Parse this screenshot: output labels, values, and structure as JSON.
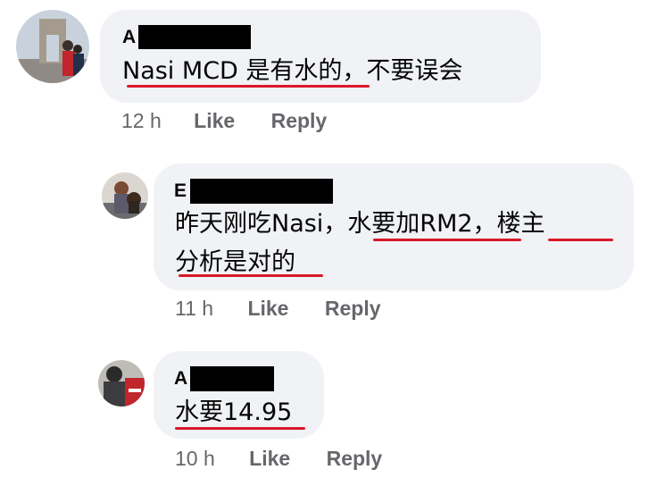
{
  "comments": [
    {
      "author_initial": "A",
      "lines": [
        "Nasi MCD 是有水的，不要误会"
      ],
      "time": "12 h",
      "like": "Like",
      "reply": "Reply"
    },
    {
      "author_initial": "E",
      "lines": [
        "昨天刚吃Nasi，水要加RM2，楼主",
        "分析是对的"
      ],
      "time": "11 h",
      "like": "Like",
      "reply": "Reply"
    },
    {
      "author_initial": "A",
      "lines": [
        "水要14.95"
      ],
      "time": "10 h",
      "like": "Like",
      "reply": "Reply"
    }
  ],
  "colors": {
    "bubble": "#f0f2f5",
    "underline": "#d91828",
    "meta_text": "#65676b",
    "redaction": "#000000"
  }
}
